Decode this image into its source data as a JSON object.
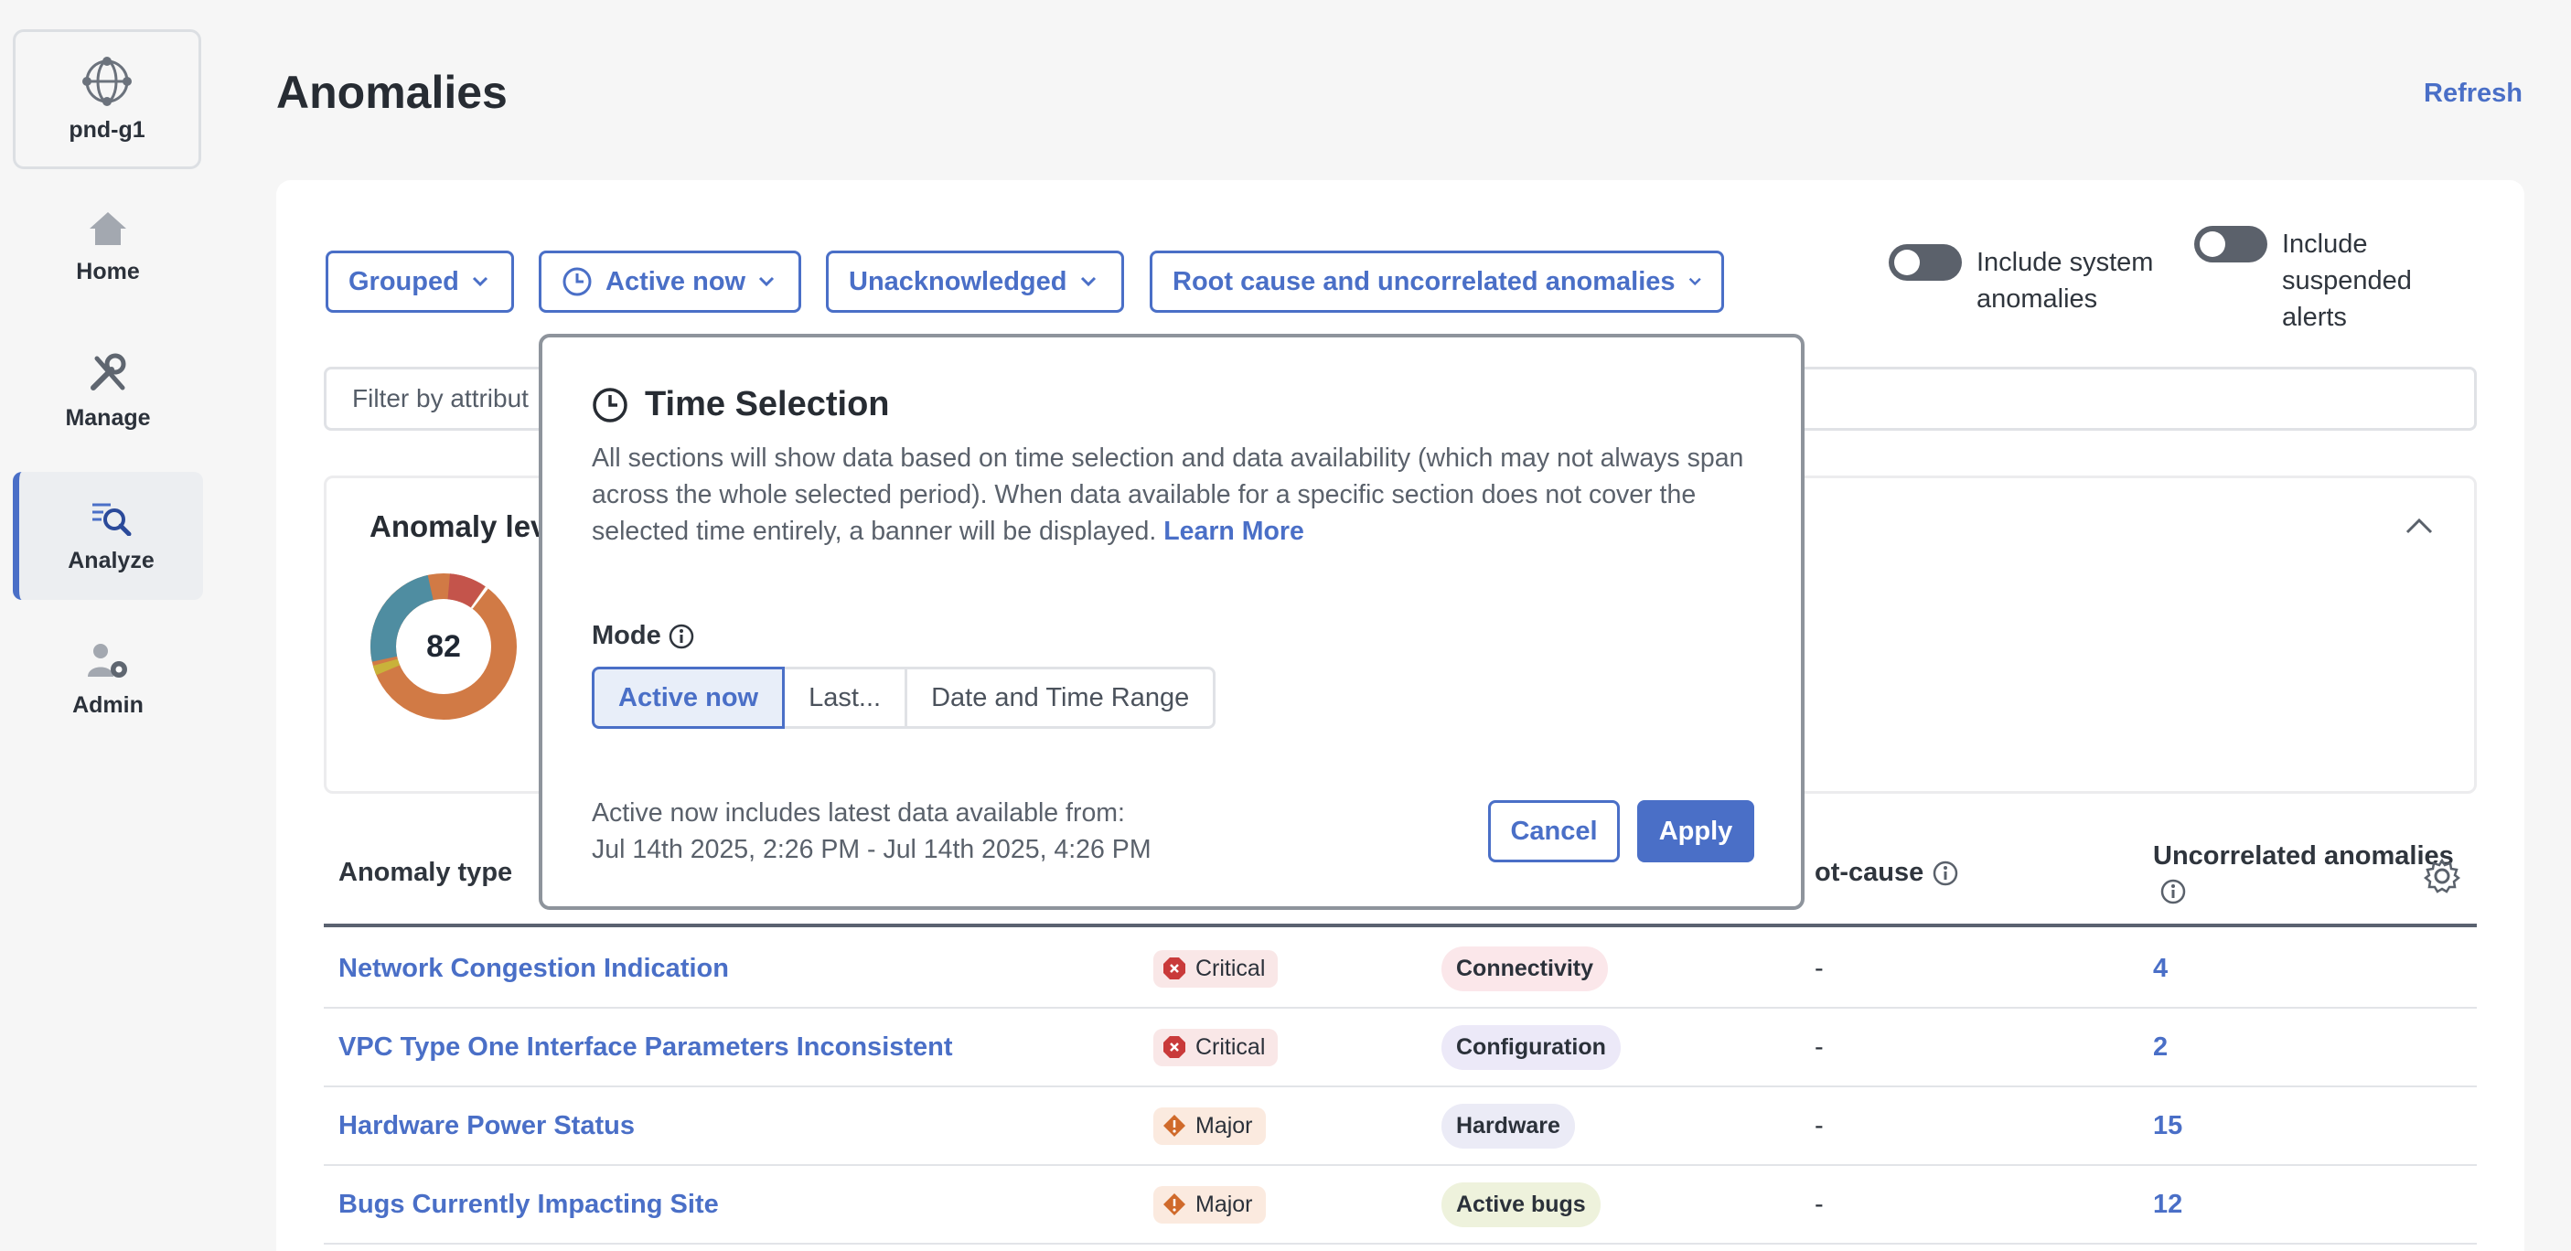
{
  "sidebar": {
    "site": "pnd-g1",
    "items": [
      {
        "label": "Home"
      },
      {
        "label": "Manage"
      },
      {
        "label": "Analyze"
      },
      {
        "label": "Admin"
      }
    ]
  },
  "header": {
    "title": "Anomalies",
    "refresh": "Refresh"
  },
  "filters": {
    "grouped": "Grouped",
    "time": "Active now",
    "ack": "Unacknowledged",
    "scope": "Root cause and uncorrelated anomalies",
    "toggle_system": "Include system anomalies",
    "toggle_suspended": "Include suspended alerts",
    "search_placeholder": "Filter by attribut"
  },
  "anomaly_level": {
    "title": "Anomaly lev",
    "total": "82",
    "colors": {
      "critical": "#c4544b",
      "major": "#d17a45",
      "minor": "#c9b23a",
      "warning": "#4f8da1"
    }
  },
  "table": {
    "headers": {
      "type": "Anomaly type",
      "root": "ot-cause",
      "uncorrelated": "Uncorrelated anomalies"
    },
    "rows": [
      {
        "type": "Network Congestion Indication",
        "severity": "Critical",
        "category": "Connectivity",
        "root": "-",
        "count": "4"
      },
      {
        "type": "VPC Type One Interface Parameters Inconsistent",
        "severity": "Critical",
        "category": "Configuration",
        "root": "-",
        "count": "2"
      },
      {
        "type": "Hardware Power Status",
        "severity": "Major",
        "category": "Hardware",
        "root": "-",
        "count": "15"
      },
      {
        "type": "Bugs Currently Impacting Site",
        "severity": "Major",
        "category": "Active bugs",
        "root": "-",
        "count": "12"
      }
    ]
  },
  "modal": {
    "title": "Time Selection",
    "description": "All sections will show data based on time selection and data availability (which may not always span across the whole selected period). When data available for a specific section does not cover the selected time entirely, a banner will be displayed.",
    "learn_more": "Learn More",
    "mode_label": "Mode",
    "modes": [
      "Active now",
      "Last...",
      "Date and Time Range"
    ],
    "note_line1": "Active now includes latest data available from:",
    "note_line2": "Jul 14th 2025, 2:26 PM - Jul 14th 2025, 4:26 PM",
    "cancel": "Cancel",
    "apply": "Apply"
  }
}
